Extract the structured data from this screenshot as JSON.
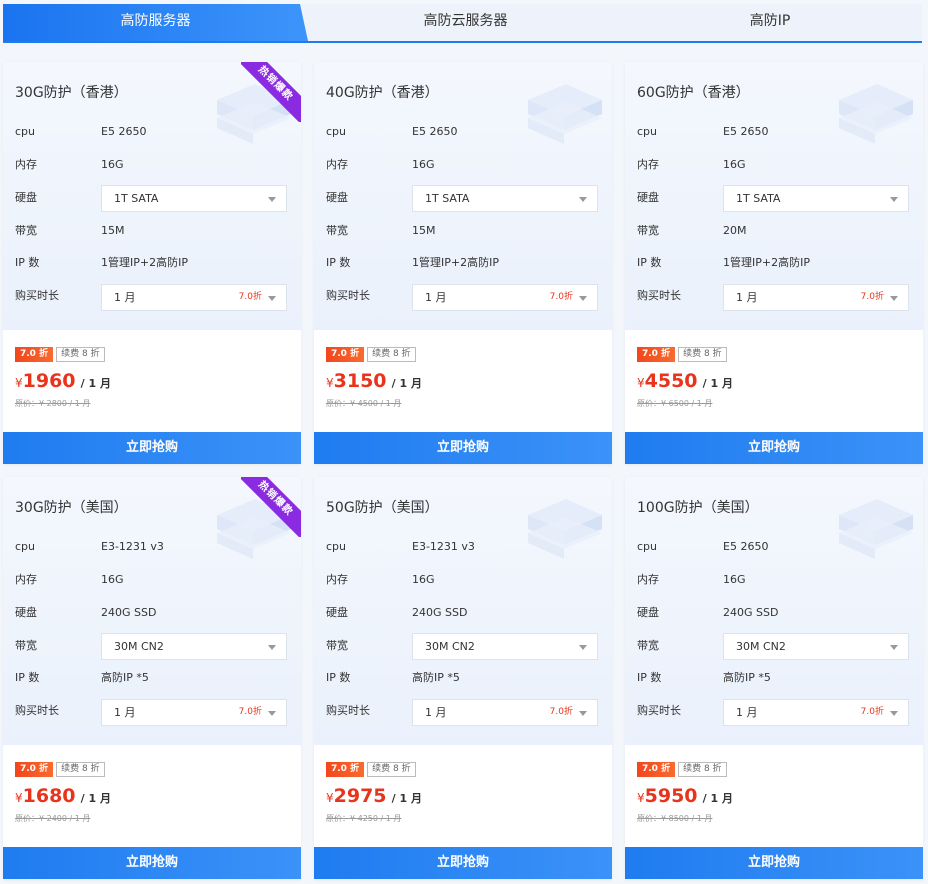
{
  "tabs": [
    {
      "label": "高防服务器"
    },
    {
      "label": "高防云服务器"
    },
    {
      "label": "高防IP"
    }
  ],
  "labels": {
    "cpu": "cpu",
    "memory": "内存",
    "disk": "硬盘",
    "bandwidth": "带宽",
    "ip": "IP 数",
    "duration": "购买时长",
    "hot": "热销爆款",
    "buy": "立即抢购"
  },
  "colors": {
    "accent": "#1f7cf0",
    "price": "#e8341c",
    "ribbon": "#8a2be2"
  },
  "cards": [
    {
      "title": "30G防护（香港）",
      "hot": true,
      "cpu": "E5 2650",
      "memory": "16G",
      "disk": "1T SATA",
      "bandwidth": "15M",
      "ip": "1管理IP+2高防IP",
      "duration": "1 月",
      "duration_discount": "7.0折",
      "badge_discount": "7.0 折",
      "badge_renew": "续费 8 折",
      "currency": "¥",
      "price": "1960",
      "unit": "/ 1 月",
      "original": "原价：¥ 2800 / 1 月"
    },
    {
      "title": "40G防护（香港）",
      "hot": false,
      "cpu": "E5 2650",
      "memory": "16G",
      "disk": "1T SATA",
      "bandwidth": "15M",
      "ip": "1管理IP+2高防IP",
      "duration": "1 月",
      "duration_discount": "7.0折",
      "badge_discount": "7.0 折",
      "badge_renew": "续费 8 折",
      "currency": "¥",
      "price": "3150",
      "unit": "/ 1 月",
      "original": "原价：¥ 4500 / 1 月"
    },
    {
      "title": "60G防护（香港）",
      "hot": false,
      "cpu": "E5 2650",
      "memory": "16G",
      "disk": "1T SATA",
      "bandwidth": "20M",
      "ip": "1管理IP+2高防IP",
      "duration": "1 月",
      "duration_discount": "7.0折",
      "badge_discount": "7.0 折",
      "badge_renew": "续费 8 折",
      "currency": "¥",
      "price": "4550",
      "unit": "/ 1 月",
      "original": "原价：¥ 6500 / 1 月"
    },
    {
      "title": "30G防护（美国）",
      "hot": true,
      "cpu": "E3-1231 v3",
      "memory": "16G",
      "disk": "240G SSD",
      "bandwidth": "30M CN2",
      "ip": "高防IP *5",
      "duration": "1 月",
      "duration_discount": "7.0折",
      "badge_discount": "7.0 折",
      "badge_renew": "续费 8 折",
      "currency": "¥",
      "price": "1680",
      "unit": "/ 1 月",
      "original": "原价：¥ 2400 / 1 月"
    },
    {
      "title": "50G防护（美国）",
      "hot": false,
      "cpu": "E3-1231 v3",
      "memory": "16G",
      "disk": "240G SSD",
      "bandwidth": "30M CN2",
      "ip": "高防IP *5",
      "duration": "1 月",
      "duration_discount": "7.0折",
      "badge_discount": "7.0 折",
      "badge_renew": "续费 8 折",
      "currency": "¥",
      "price": "2975",
      "unit": "/ 1 月",
      "original": "原价：¥ 4250 / 1 月"
    },
    {
      "title": "100G防护（美国）",
      "hot": false,
      "cpu": "E5 2650",
      "memory": "16G",
      "disk": "240G SSD",
      "bandwidth": "30M CN2",
      "ip": "高防IP *5",
      "duration": "1 月",
      "duration_discount": "7.0折",
      "badge_discount": "7.0 折",
      "badge_renew": "续费 8 折",
      "currency": "¥",
      "price": "5950",
      "unit": "/ 1 月",
      "original": "原价：¥ 8500 / 1 月"
    }
  ]
}
